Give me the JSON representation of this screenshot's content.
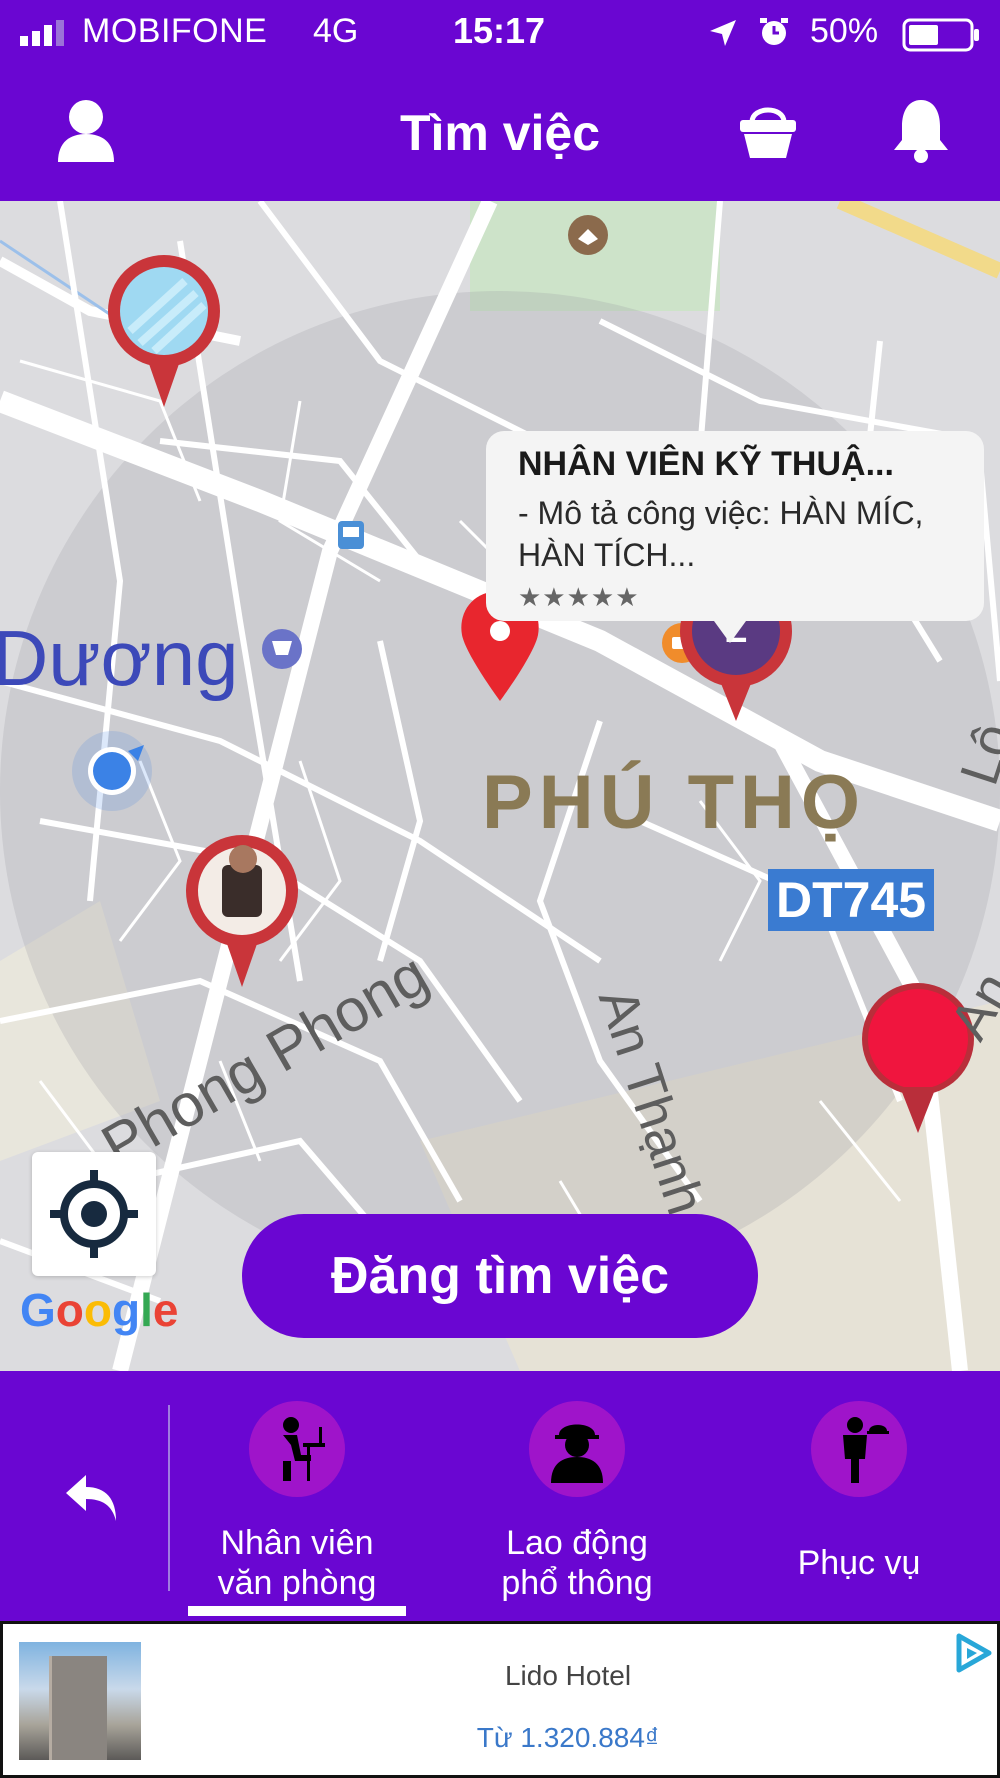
{
  "status_bar": {
    "carrier": "MOBIFONE",
    "network": "4G",
    "time": "15:17",
    "battery_text": "50%",
    "battery_level": 0.5,
    "icons": [
      "signal-icon",
      "location-arrow-icon",
      "alarm-icon",
      "battery-icon"
    ]
  },
  "header": {
    "title": "Tìm việc",
    "icons": [
      "user-icon",
      "basket-icon",
      "bell-icon"
    ]
  },
  "map": {
    "labels": {
      "district": "Dương",
      "ward": "PHÚ THỌ",
      "road": "DT745",
      "street1": "Phong Phong",
      "street2": "An Thạnh",
      "street3": "Lô",
      "street4": "An"
    },
    "callout": {
      "title": "NHÂN VIÊN KỸ THUẬ...",
      "description": "- Mô tả công việc: HÀN MÍC, HÀN TÍCH...",
      "stars": "★★★★★"
    },
    "marker_letter": "L",
    "google": "Google",
    "post_button": "Đăng tìm việc",
    "colors": {
      "pin_red": "#e8262e",
      "marker_border": "#c9353a",
      "user_dot": "#3b82e6",
      "road_badge": "#3a7bd1"
    }
  },
  "categories": {
    "items": [
      {
        "label": "Nhân viên văn phòng",
        "line1": "Nhân viên",
        "line2": "văn phòng",
        "icon": "office-worker-icon",
        "selected": true
      },
      {
        "label": "Lao động phổ thông",
        "line1": "Lao động",
        "line2": "phổ thông",
        "icon": "construction-worker-icon",
        "selected": false
      },
      {
        "label": "Phục vụ",
        "line1": "Phục vụ",
        "icon": "waiter-icon",
        "selected": false
      }
    ],
    "back_icon": "back-arrow-icon"
  },
  "ad": {
    "name": "Lido Hotel",
    "price": "Từ 1.320.884₫",
    "icon": "adchoices-icon"
  },
  "colors": {
    "brand": "#6a06d2",
    "category_circle": "#9f14ca"
  }
}
